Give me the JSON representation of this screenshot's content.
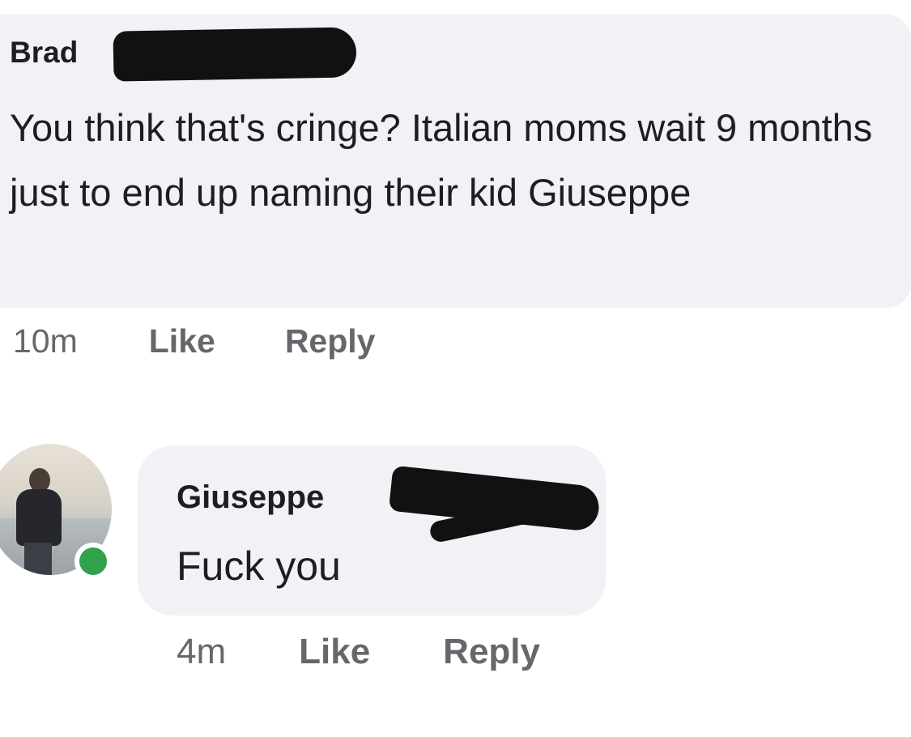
{
  "comments": [
    {
      "author": "Brad",
      "text": "You think that's cringe? Italian moms wait 9 months just to end up naming their kid Giuseppe",
      "time": "10m",
      "like_label": "Like",
      "reply_label": "Reply"
    },
    {
      "author": "Giuseppe",
      "text": "Fuck you",
      "time": "4m",
      "like_label": "Like",
      "reply_label": "Reply",
      "online_status_color": "#31a24c"
    }
  ],
  "colors": {
    "bubble_background": "#f0f2f5",
    "meta_text": "#65676b",
    "body_text": "#1c1e21",
    "redaction": "#111111"
  }
}
